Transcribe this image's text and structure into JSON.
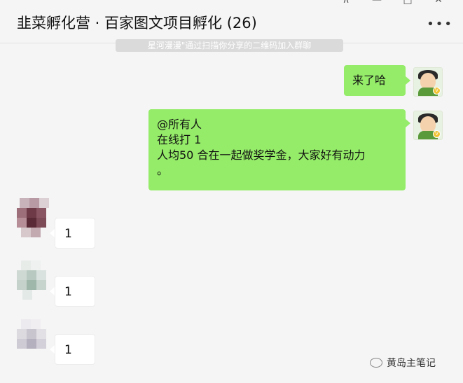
{
  "header": {
    "title": "韭菜孵化营 · 百家图文项目孵化 (26)",
    "more_glyph": "•••",
    "controls": [
      "⊼",
      "—",
      "□",
      "✕"
    ]
  },
  "system_notice": "星河漫漫\"通过扫描你分享的二维码加入群聊",
  "messages": {
    "self_1": "来了哈",
    "self_2": [
      "@所有人",
      "在线打 1",
      "人均50  合在一起做奖学金，大家好有动力",
      "。"
    ],
    "reply_1": "1",
    "reply_2": "1",
    "reply_3": "1"
  },
  "watermark": "黄岛主笔记",
  "colors": {
    "bubble_self": "#95ec69",
    "bubble_other": "#ffffff",
    "background": "#f5f5f5"
  }
}
